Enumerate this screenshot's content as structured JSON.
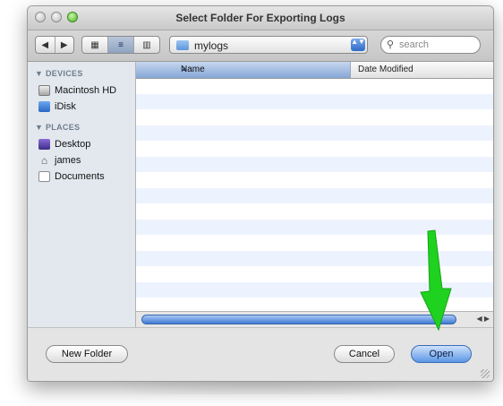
{
  "window": {
    "title": "Select Folder For Exporting Logs"
  },
  "toolbar": {
    "nav_back": "◀",
    "nav_forward": "▶",
    "view_icon": "▦",
    "view_list": "≡",
    "view_columns": "▥",
    "location": "mylogs",
    "location_arrows": "▲▼",
    "search_placeholder": "search",
    "search_glyph": "⚲"
  },
  "sidebar": {
    "devices_label": "▼ DEVICES",
    "devices": [
      {
        "label": "Macintosh HD"
      },
      {
        "label": "iDisk"
      }
    ],
    "places_label": "▼ PLACES",
    "places": [
      {
        "label": "Desktop"
      },
      {
        "label": "james"
      },
      {
        "label": "Documents"
      }
    ]
  },
  "list": {
    "col_name": "Name",
    "col_date": "Date Modified",
    "sort_glyph": "▲",
    "scroll_arrows": "◀ ▶"
  },
  "buttons": {
    "new_folder": "New Folder",
    "cancel": "Cancel",
    "open": "Open"
  },
  "colors": {
    "arrow": "#1fd21f",
    "selection": "#5c97e6"
  },
  "icons": {
    "arrow": "green-down-arrow-icon"
  }
}
